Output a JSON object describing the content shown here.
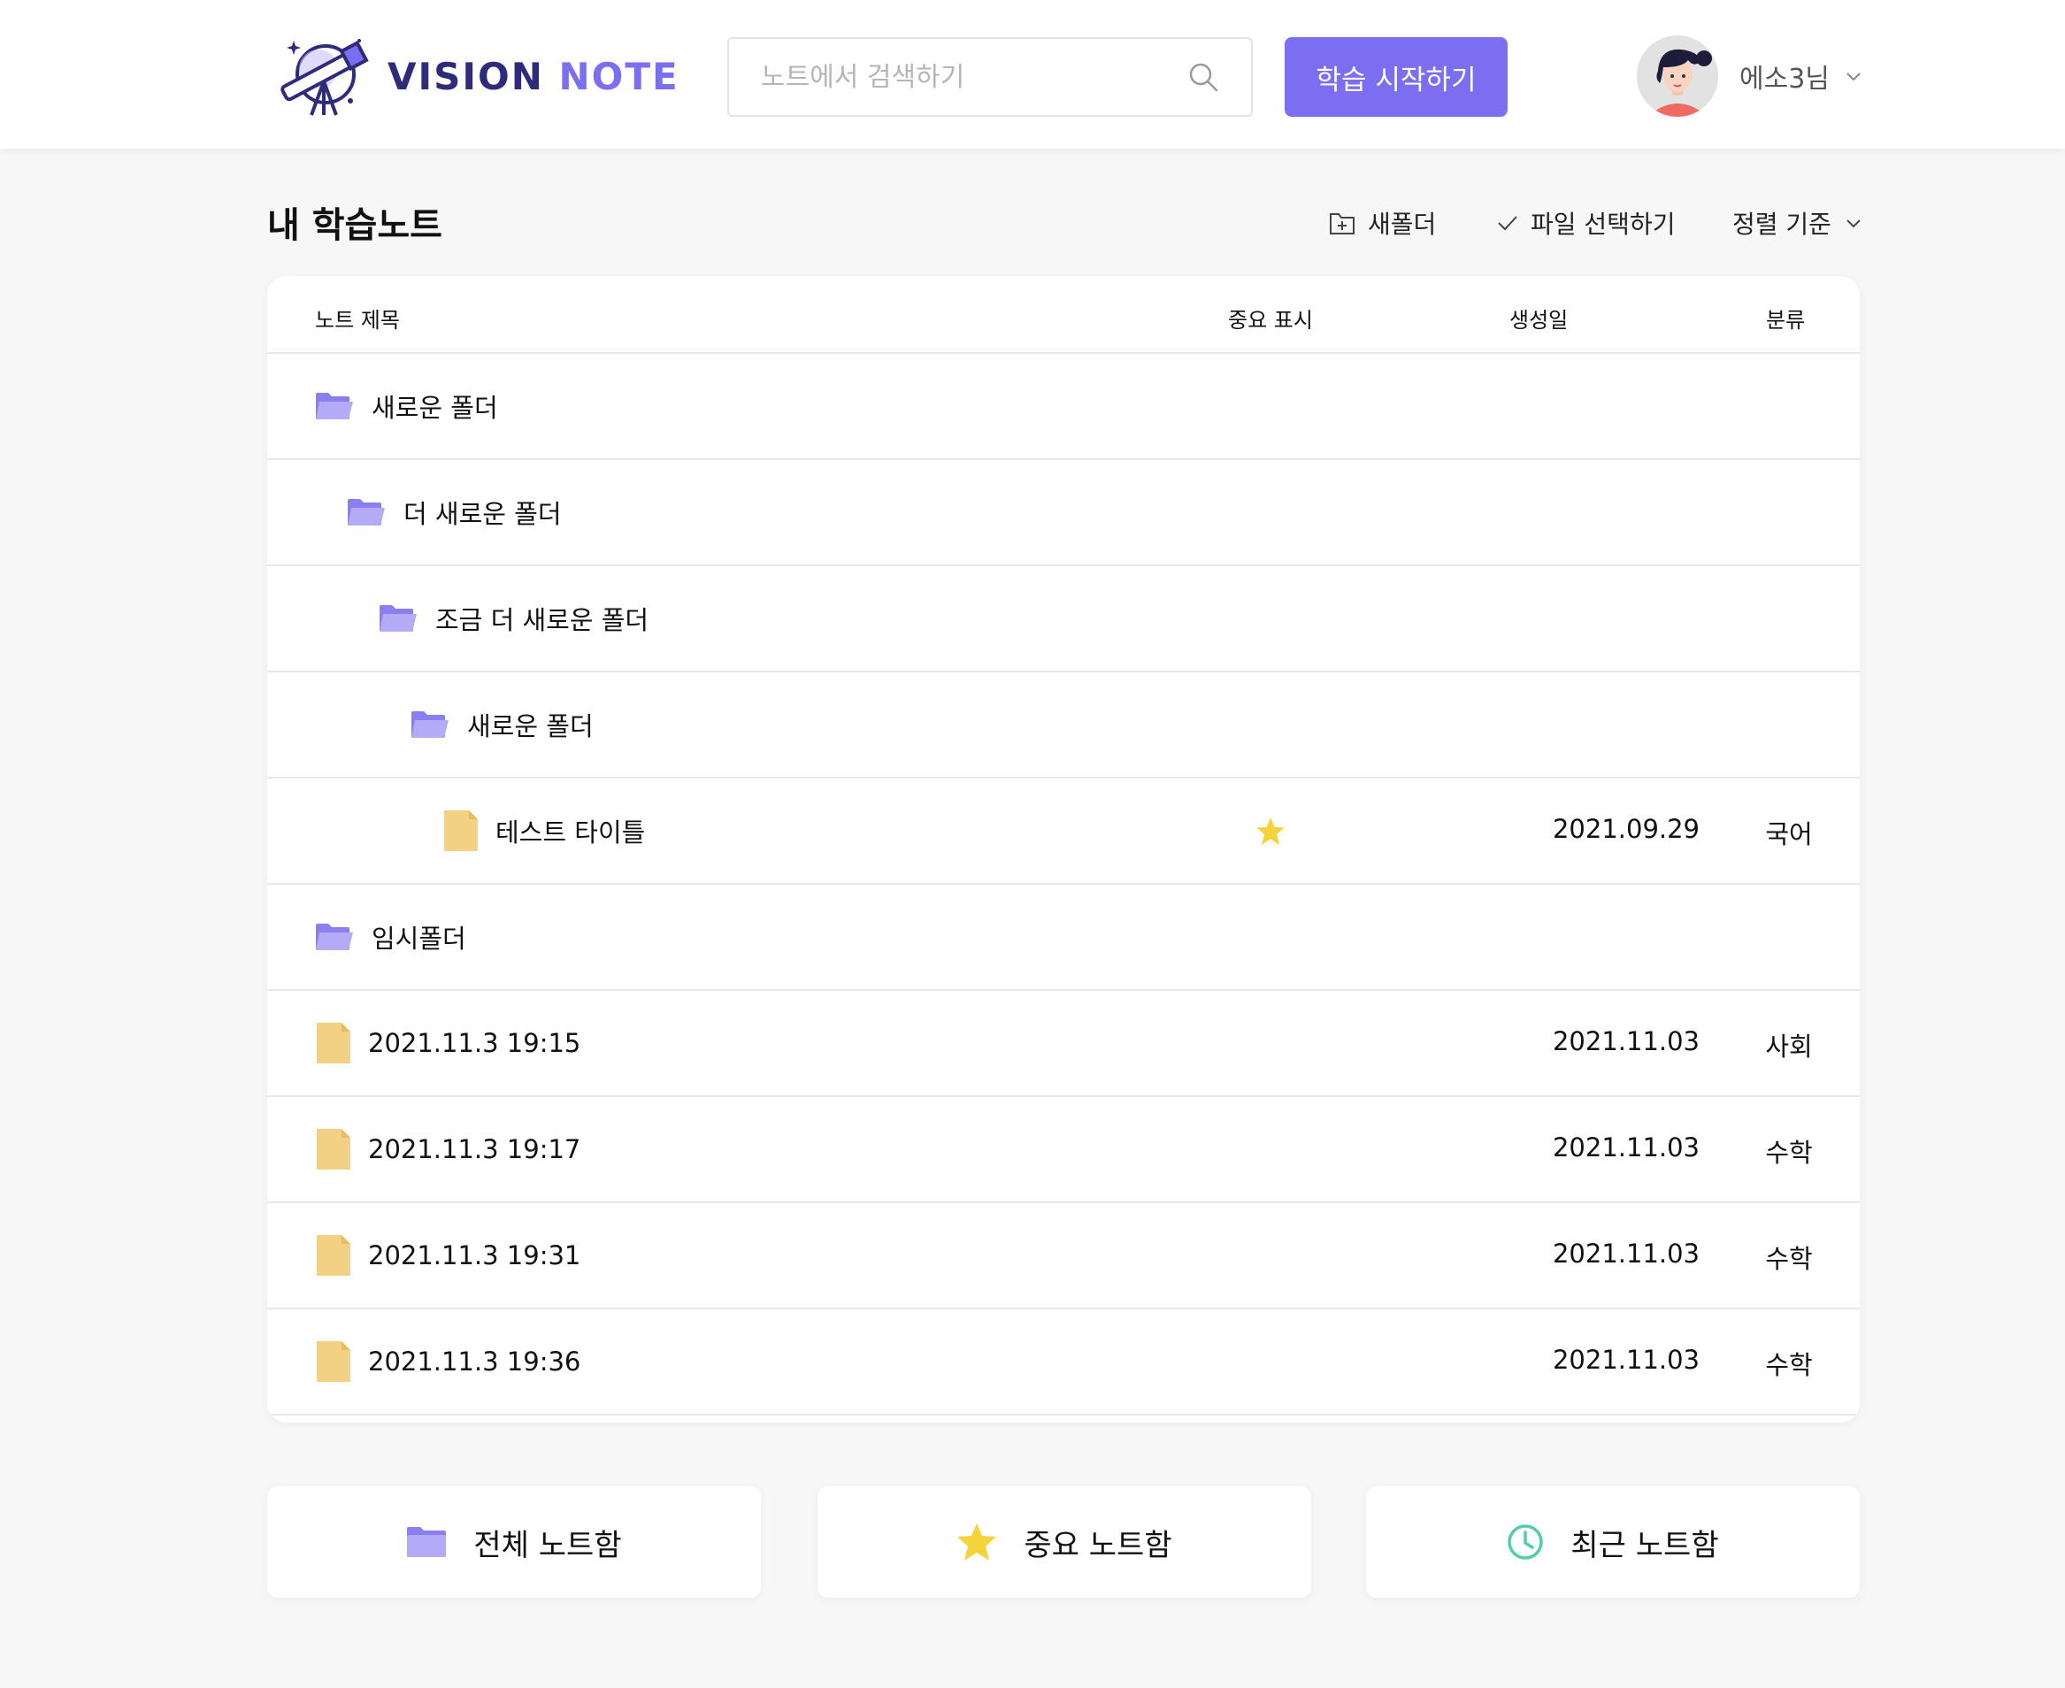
{
  "header": {
    "logo_vision": "VISION",
    "logo_note": "NOTE",
    "search_placeholder": "노트에서 검색하기",
    "start_button": "학습 시작하기",
    "username": "에소3님"
  },
  "section": {
    "title": "내 학습노트",
    "new_folder": "새폴더",
    "select_files": "파일 선택하기",
    "sort": "정렬 기준"
  },
  "table": {
    "columns": {
      "title": "노트 제목",
      "important": "중요 표시",
      "created": "생성일",
      "category": "분류"
    },
    "rows": [
      {
        "type": "folder",
        "label": "새로운 폴더",
        "important": false,
        "created": "",
        "category": ""
      },
      {
        "type": "folder",
        "label": "더 새로운 폴더",
        "important": false,
        "created": "",
        "category": ""
      },
      {
        "type": "folder",
        "label": "조금 더 새로운 폴더",
        "important": false,
        "created": "",
        "category": ""
      },
      {
        "type": "folder",
        "label": "새로운 폴더",
        "important": false,
        "created": "",
        "category": ""
      },
      {
        "type": "file",
        "label": "테스트 타이틀",
        "important": true,
        "created": "2021.09.29",
        "category": "국어"
      },
      {
        "type": "folder",
        "label": "임시폴더",
        "important": false,
        "created": "",
        "category": ""
      },
      {
        "type": "file",
        "label": "2021.11.3 19:15",
        "important": false,
        "created": "2021.11.03",
        "category": "사회"
      },
      {
        "type": "file",
        "label": "2021.11.3 19:17",
        "important": false,
        "created": "2021.11.03",
        "category": "수학"
      },
      {
        "type": "file",
        "label": "2021.11.3 19:31",
        "important": false,
        "created": "2021.11.03",
        "category": "수학"
      },
      {
        "type": "file",
        "label": "2021.11.3 19:36",
        "important": false,
        "created": "2021.11.03",
        "category": "수학"
      }
    ]
  },
  "boxes": {
    "all": "전체 노트함",
    "important": "중요 노트함",
    "recent": "최근 노트함"
  },
  "colors": {
    "accent": "#7b6ef0",
    "logo_dark": "#2d2b7a",
    "folder": "#9d92f2",
    "file": "#f2d184",
    "star": "#f5d33a",
    "clock": "#4fcfa8"
  }
}
